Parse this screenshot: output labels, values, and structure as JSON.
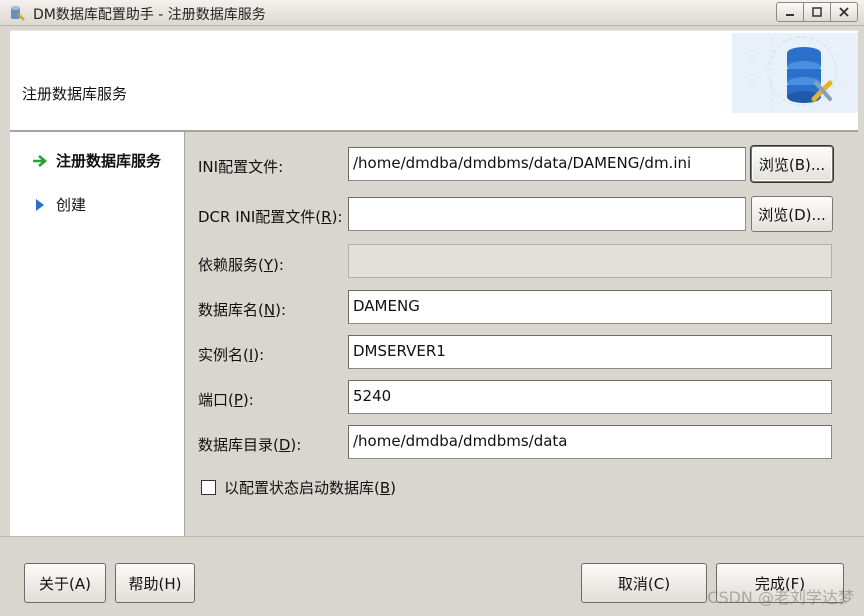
{
  "window": {
    "title": "DM数据库配置助手 - 注册数据库服务"
  },
  "header": {
    "title": "注册数据库服务"
  },
  "sidebar": {
    "items": [
      {
        "label": "注册数据库服务",
        "active": true
      },
      {
        "label": "创建",
        "active": false
      }
    ]
  },
  "form": {
    "ini_label": "INI配置文件:",
    "ini_value": "/home/dmdba/dmdbms/data/DAMENG/dm.ini",
    "browse_b_label": "浏览(B)...",
    "dcr_label_pre": "DCR INI配置文件(",
    "dcr_label_key": "R",
    "dcr_label_post": "):",
    "dcr_value": "",
    "browse_d_label": "浏览(D)...",
    "dep_label_pre": "依赖服务(",
    "dep_label_key": "Y",
    "dep_label_post": "):",
    "dep_value": "",
    "dbname_label_pre": "数据库名(",
    "dbname_label_key": "N",
    "dbname_label_post": "):",
    "dbname_value": "DAMENG",
    "inst_label_pre": "实例名(",
    "inst_label_key": "I",
    "inst_label_post": "):",
    "inst_value": "DMSERVER1",
    "port_label_pre": "端口(",
    "port_label_key": "P",
    "port_label_post": "):",
    "port_value": "5240",
    "dir_label_pre": "数据库目录(",
    "dir_label_key": "D",
    "dir_label_post": "):",
    "dir_value": "/home/dmdba/dmdbms/data",
    "checkbox_label_pre": "以配置状态启动数据库(",
    "checkbox_label_key": "B",
    "checkbox_label_post": ")",
    "checkbox_checked": false
  },
  "footer": {
    "about_label": "关于(A)",
    "help_label": "帮助(H)",
    "cancel_label": "取消(C)",
    "finish_label": "完成(F)"
  },
  "watermark": "CSDN @老刘学达梦",
  "colors": {
    "active_arrow": "#2e9e3a",
    "inactive_arrow": "#2a6fc9"
  },
  "icons": {
    "app": "database-config-icon",
    "header": "database-tools-icon"
  }
}
